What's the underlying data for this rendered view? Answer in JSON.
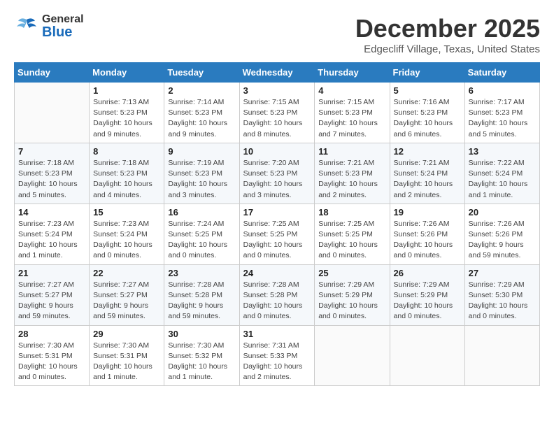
{
  "header": {
    "logo_general": "General",
    "logo_blue": "Blue",
    "month_title": "December 2025",
    "location": "Edgecliff Village, Texas, United States"
  },
  "days_of_week": [
    "Sunday",
    "Monday",
    "Tuesday",
    "Wednesday",
    "Thursday",
    "Friday",
    "Saturday"
  ],
  "weeks": [
    [
      {
        "day": "",
        "info": ""
      },
      {
        "day": "1",
        "info": "Sunrise: 7:13 AM\nSunset: 5:23 PM\nDaylight: 10 hours\nand 9 minutes."
      },
      {
        "day": "2",
        "info": "Sunrise: 7:14 AM\nSunset: 5:23 PM\nDaylight: 10 hours\nand 9 minutes."
      },
      {
        "day": "3",
        "info": "Sunrise: 7:15 AM\nSunset: 5:23 PM\nDaylight: 10 hours\nand 8 minutes."
      },
      {
        "day": "4",
        "info": "Sunrise: 7:15 AM\nSunset: 5:23 PM\nDaylight: 10 hours\nand 7 minutes."
      },
      {
        "day": "5",
        "info": "Sunrise: 7:16 AM\nSunset: 5:23 PM\nDaylight: 10 hours\nand 6 minutes."
      },
      {
        "day": "6",
        "info": "Sunrise: 7:17 AM\nSunset: 5:23 PM\nDaylight: 10 hours\nand 5 minutes."
      }
    ],
    [
      {
        "day": "7",
        "info": "Sunrise: 7:18 AM\nSunset: 5:23 PM\nDaylight: 10 hours\nand 5 minutes."
      },
      {
        "day": "8",
        "info": "Sunrise: 7:18 AM\nSunset: 5:23 PM\nDaylight: 10 hours\nand 4 minutes."
      },
      {
        "day": "9",
        "info": "Sunrise: 7:19 AM\nSunset: 5:23 PM\nDaylight: 10 hours\nand 3 minutes."
      },
      {
        "day": "10",
        "info": "Sunrise: 7:20 AM\nSunset: 5:23 PM\nDaylight: 10 hours\nand 3 minutes."
      },
      {
        "day": "11",
        "info": "Sunrise: 7:21 AM\nSunset: 5:23 PM\nDaylight: 10 hours\nand 2 minutes."
      },
      {
        "day": "12",
        "info": "Sunrise: 7:21 AM\nSunset: 5:24 PM\nDaylight: 10 hours\nand 2 minutes."
      },
      {
        "day": "13",
        "info": "Sunrise: 7:22 AM\nSunset: 5:24 PM\nDaylight: 10 hours\nand 1 minute."
      }
    ],
    [
      {
        "day": "14",
        "info": "Sunrise: 7:23 AM\nSunset: 5:24 PM\nDaylight: 10 hours\nand 1 minute."
      },
      {
        "day": "15",
        "info": "Sunrise: 7:23 AM\nSunset: 5:24 PM\nDaylight: 10 hours\nand 0 minutes."
      },
      {
        "day": "16",
        "info": "Sunrise: 7:24 AM\nSunset: 5:25 PM\nDaylight: 10 hours\nand 0 minutes."
      },
      {
        "day": "17",
        "info": "Sunrise: 7:25 AM\nSunset: 5:25 PM\nDaylight: 10 hours\nand 0 minutes."
      },
      {
        "day": "18",
        "info": "Sunrise: 7:25 AM\nSunset: 5:25 PM\nDaylight: 10 hours\nand 0 minutes."
      },
      {
        "day": "19",
        "info": "Sunrise: 7:26 AM\nSunset: 5:26 PM\nDaylight: 10 hours\nand 0 minutes."
      },
      {
        "day": "20",
        "info": "Sunrise: 7:26 AM\nSunset: 5:26 PM\nDaylight: 9 hours\nand 59 minutes."
      }
    ],
    [
      {
        "day": "21",
        "info": "Sunrise: 7:27 AM\nSunset: 5:27 PM\nDaylight: 9 hours\nand 59 minutes."
      },
      {
        "day": "22",
        "info": "Sunrise: 7:27 AM\nSunset: 5:27 PM\nDaylight: 9 hours\nand 59 minutes."
      },
      {
        "day": "23",
        "info": "Sunrise: 7:28 AM\nSunset: 5:28 PM\nDaylight: 9 hours\nand 59 minutes."
      },
      {
        "day": "24",
        "info": "Sunrise: 7:28 AM\nSunset: 5:28 PM\nDaylight: 10 hours\nand 0 minutes."
      },
      {
        "day": "25",
        "info": "Sunrise: 7:29 AM\nSunset: 5:29 PM\nDaylight: 10 hours\nand 0 minutes."
      },
      {
        "day": "26",
        "info": "Sunrise: 7:29 AM\nSunset: 5:29 PM\nDaylight: 10 hours\nand 0 minutes."
      },
      {
        "day": "27",
        "info": "Sunrise: 7:29 AM\nSunset: 5:30 PM\nDaylight: 10 hours\nand 0 minutes."
      }
    ],
    [
      {
        "day": "28",
        "info": "Sunrise: 7:30 AM\nSunset: 5:31 PM\nDaylight: 10 hours\nand 0 minutes."
      },
      {
        "day": "29",
        "info": "Sunrise: 7:30 AM\nSunset: 5:31 PM\nDaylight: 10 hours\nand 1 minute."
      },
      {
        "day": "30",
        "info": "Sunrise: 7:30 AM\nSunset: 5:32 PM\nDaylight: 10 hours\nand 1 minute."
      },
      {
        "day": "31",
        "info": "Sunrise: 7:31 AM\nSunset: 5:33 PM\nDaylight: 10 hours\nand 2 minutes."
      },
      {
        "day": "",
        "info": ""
      },
      {
        "day": "",
        "info": ""
      },
      {
        "day": "",
        "info": ""
      }
    ]
  ]
}
